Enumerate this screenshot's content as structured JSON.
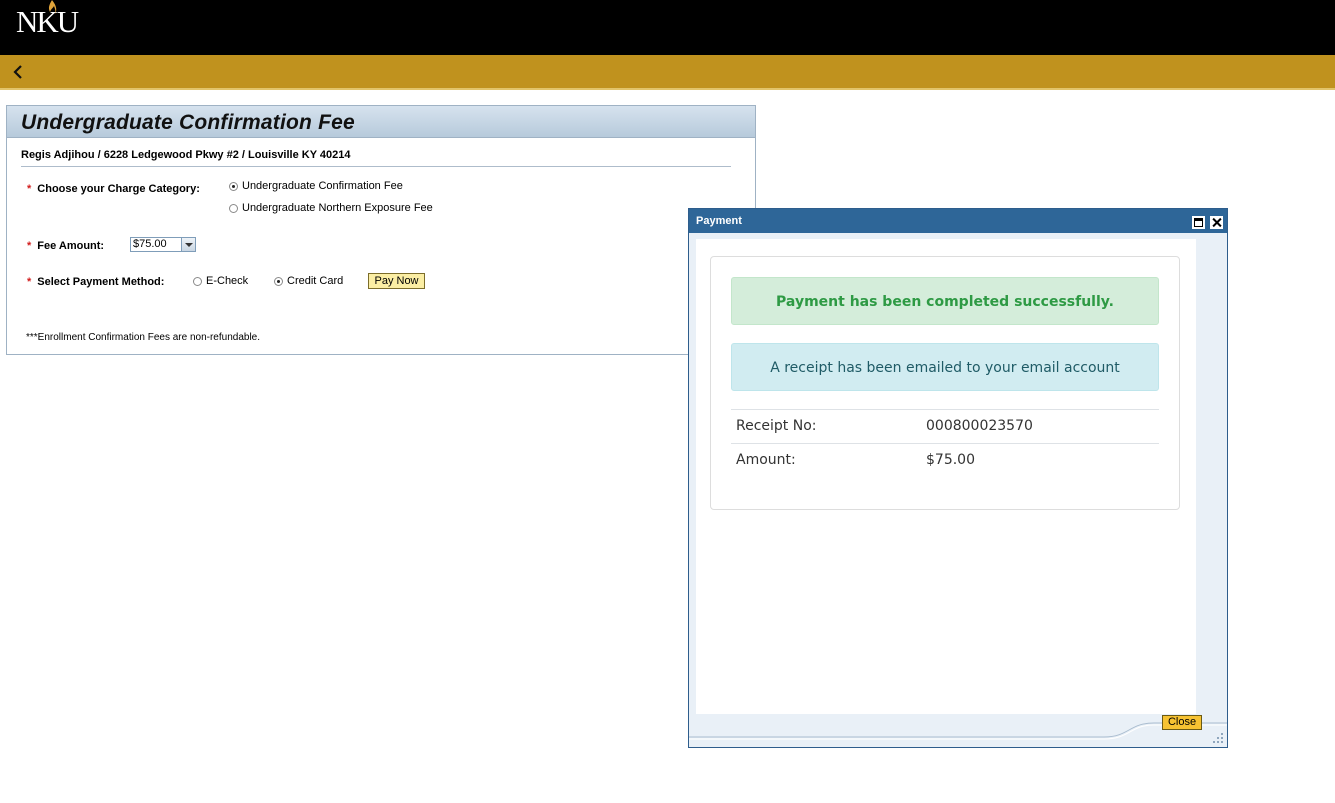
{
  "header": {
    "logo_text": "NKU",
    "colors": {
      "topbar": "#000000",
      "navbar": "#c0921e",
      "flame": "#e0a43a"
    }
  },
  "nav": {
    "back_icon": "chevron-left-icon"
  },
  "panel": {
    "title": "Undergraduate Confirmation Fee",
    "address": "Regis Adjihou / 6228 Ledgewood Pkwy #2 / Louisville KY 40214",
    "required_mark": "*",
    "charge_category": {
      "label": "Choose your Charge Category:",
      "options": [
        {
          "label": "Undergraduate Confirmation Fee",
          "selected": true
        },
        {
          "label": "Undergraduate Northern Exposure Fee",
          "selected": false
        }
      ]
    },
    "fee_amount": {
      "label": "Fee Amount:",
      "value": "$75.00"
    },
    "payment_method": {
      "label": "Select Payment Method:",
      "options": [
        {
          "label": "E-Check",
          "selected": false
        },
        {
          "label": "Credit Card",
          "selected": true
        }
      ],
      "pay_button": "Pay Now"
    },
    "note": "***Enrollment Confirmation Fees are non-refundable."
  },
  "modal": {
    "title": "Payment",
    "success_message": "Payment has been completed successfully.",
    "info_message": "A receipt has been emailed to your email account",
    "receipt": [
      {
        "key": "Receipt No:",
        "value": "000800023570"
      },
      {
        "key": "Amount:",
        "value": "$75.00"
      }
    ],
    "close_button": "Close"
  }
}
